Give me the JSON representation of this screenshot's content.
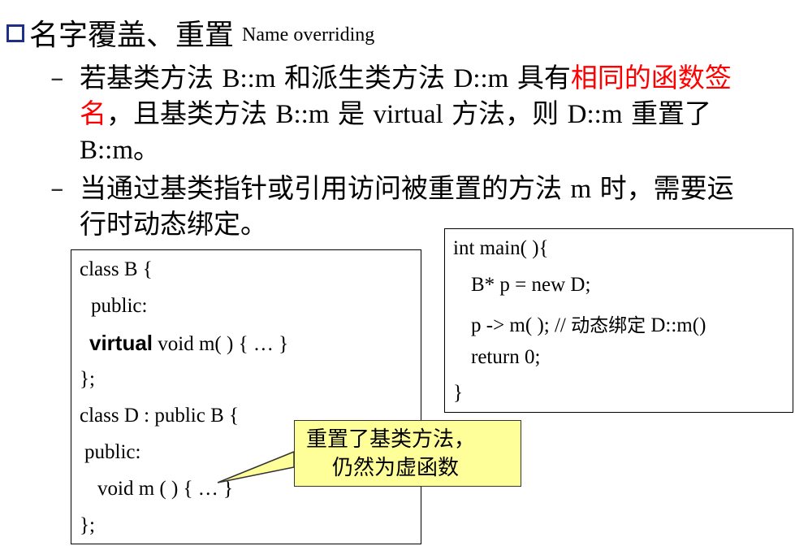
{
  "title": {
    "main": "名字覆盖、重置",
    "english": "Name overriding"
  },
  "bullets": [
    {
      "dash": "–",
      "line1_a": "若基类方法 ",
      "line1_b": "B::m",
      "line1_c": " 和派生类方法 ",
      "line1_d": "D::m",
      "line1_e": " 具有",
      "line1_red": "相同的函数签",
      "line2_red": "名",
      "line2_a": "，且基类方法 ",
      "line2_b": "B::m",
      "line2_c": " 是 ",
      "line2_d": "virtual",
      "line2_e": " 方法，则 ",
      "line2_f": "D::m",
      "line2_g": "  重置了",
      "line3_a": "B::m",
      "line3_b": "。"
    },
    {
      "dash": "–",
      "line1_a": "当通过基类指针或引用访问被重置的方法 ",
      "line1_b": "m",
      "line1_c": " 时，需要运",
      "line2": "行时动态绑定。"
    }
  ],
  "code_left": {
    "l1": "class B {",
    "l2": "public:",
    "l3_kw": "virtual",
    "l3_rest": "  void m( ) { … }",
    "l4": "};",
    "l5": "class  D : public B {",
    "l6": "public:",
    "l7": "void m ( ) { … }",
    "l8": "};"
  },
  "code_right": {
    "l1": "int  main( ){",
    "l2": "B*  p = new D;",
    "l3_code": "p -> m( );   // ",
    "l3_cn": "动态绑定",
    "l3_end": " D::m()",
    "l4": "return 0;",
    "l5": "}"
  },
  "callout": {
    "line1": "重置了基类方法，",
    "line2": "仍然为虚函数"
  },
  "colors": {
    "bullet_box": "#1f2f87",
    "highlight": "#ff0000",
    "callout_bg": "#ffff99"
  }
}
